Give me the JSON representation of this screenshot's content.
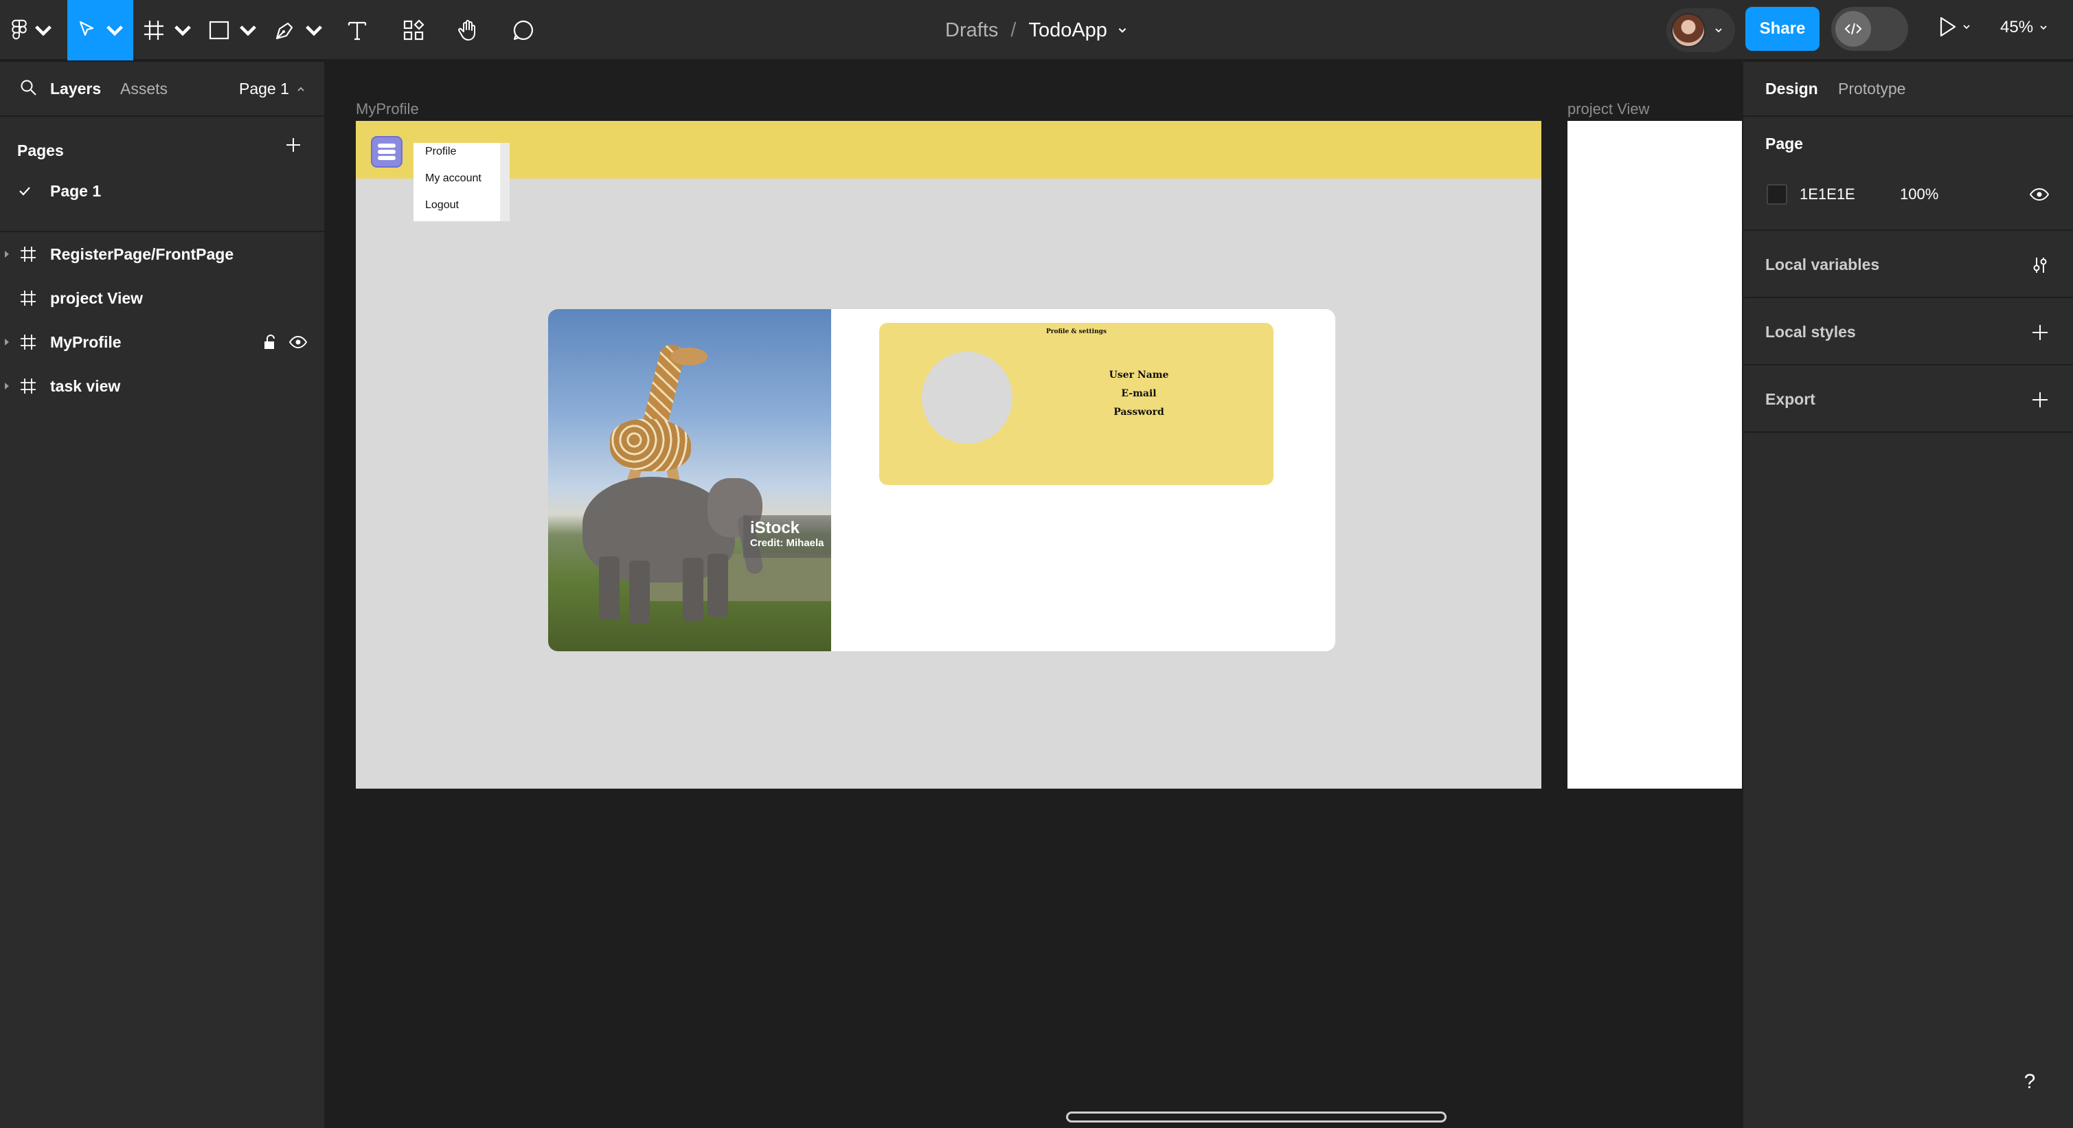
{
  "toolbar": {
    "tools": [
      {
        "name": "main-menu",
        "icon": "figma-logo-icon"
      },
      {
        "name": "move-tool",
        "icon": "cursor-icon",
        "active": true
      },
      {
        "name": "frame-tool",
        "icon": "frame-icon"
      },
      {
        "name": "shape-tool",
        "icon": "rectangle-icon"
      },
      {
        "name": "pen-tool",
        "icon": "pen-icon"
      },
      {
        "name": "text-tool",
        "icon": "text-icon"
      },
      {
        "name": "resources",
        "icon": "components-icon"
      },
      {
        "name": "hand-tool",
        "icon": "hand-icon"
      },
      {
        "name": "comment-tool",
        "icon": "comment-icon"
      }
    ],
    "breadcrumb": {
      "folder": "Drafts",
      "separator": "/",
      "file": "TodoApp"
    },
    "share_label": "Share",
    "zoom": "45%",
    "accent_color": "#0d99ff"
  },
  "left_panel": {
    "tabs": {
      "layers": "Layers",
      "assets": "Assets"
    },
    "page_selector": "Page 1",
    "pages_title": "Pages",
    "pages": [
      {
        "label": "Page 1",
        "selected": true
      }
    ],
    "layers": [
      {
        "label": "RegisterPage/FrontPage",
        "expandable": true
      },
      {
        "label": "project View",
        "expandable": false
      },
      {
        "label": "MyProfile",
        "expandable": true,
        "hovered": true
      },
      {
        "label": "task view",
        "expandable": true
      }
    ]
  },
  "right_panel": {
    "tabs": {
      "design": "Design",
      "prototype": "Prototype"
    },
    "page_section": {
      "title": "Page",
      "color": "1E1E1E",
      "opacity": "100%"
    },
    "sections": [
      {
        "label": "Local variables",
        "icon": "sliders-icon"
      },
      {
        "label": "Local styles",
        "icon": "plus-icon"
      },
      {
        "label": "Export",
        "icon": "plus-icon"
      }
    ]
  },
  "canvas": {
    "background": "#1e1e1e",
    "frames": {
      "myprofile_label": "MyProfile",
      "projectview_label": "project View"
    },
    "myprofile": {
      "header_color": "#ecd663",
      "menu_items": [
        "Profile",
        "My account",
        "Logout"
      ],
      "watermark": {
        "brand": "iStock",
        "credit": "Credit: Mihaela"
      },
      "info_box": {
        "title": "Profile & settings",
        "fields": [
          "User Name",
          "E-mail",
          "Password"
        ]
      }
    }
  },
  "help": {
    "label": "?"
  }
}
